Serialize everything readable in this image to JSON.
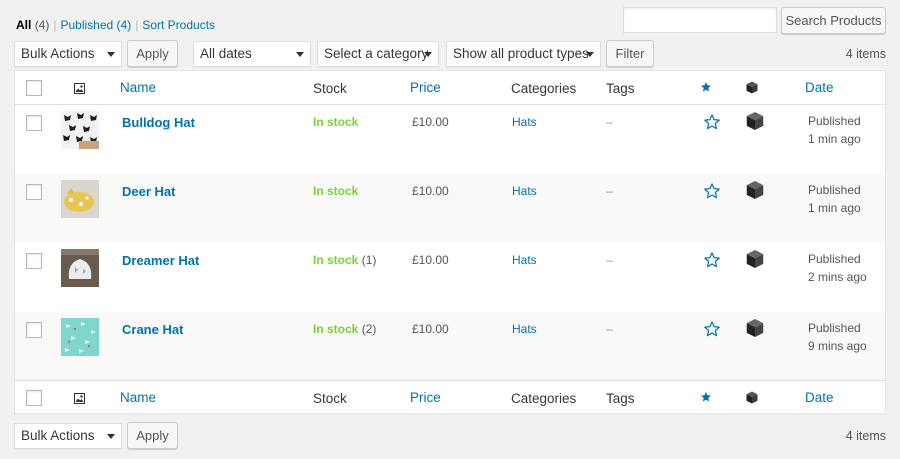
{
  "filters": {
    "all_label": "All",
    "all_count": "(4)",
    "published_label": "Published",
    "published_count": "(4)",
    "sort_label": "Sort Products",
    "separator": "|"
  },
  "search": {
    "value": "",
    "button_label": "Search Products"
  },
  "toolbar_top": {
    "bulk_actions": "Bulk Actions",
    "apply_label": "Apply",
    "dates": "All dates",
    "category": "Select a category",
    "product_type": "Show all product types",
    "filter_label": "Filter",
    "items_count": "4 items"
  },
  "table": {
    "headers": {
      "name": "Name",
      "stock": "Stock",
      "price": "Price",
      "categories": "Categories",
      "tags": "Tags",
      "date": "Date"
    },
    "rows": [
      {
        "name": "Bulldog Hat",
        "stock": "In stock",
        "stock_count": "",
        "price": "£10.00",
        "category": "Hats",
        "tags": "–",
        "status": "Published",
        "ago": "1 min ago"
      },
      {
        "name": "Deer Hat",
        "stock": "In stock",
        "stock_count": "",
        "price": "£10.00",
        "category": "Hats",
        "tags": "–",
        "status": "Published",
        "ago": "1 min ago"
      },
      {
        "name": "Dreamer Hat",
        "stock": "In stock",
        "stock_count": "(1)",
        "price": "£10.00",
        "category": "Hats",
        "tags": "–",
        "status": "Published",
        "ago": "2 mins ago"
      },
      {
        "name": "Crane Hat",
        "stock": "In stock",
        "stock_count": "(2)",
        "price": "£10.00",
        "category": "Hats",
        "tags": "–",
        "status": "Published",
        "ago": "9 mins ago"
      }
    ]
  },
  "toolbar_bottom": {
    "bulk_actions": "Bulk Actions",
    "apply_label": "Apply",
    "items_count": "4 items"
  },
  "colors": {
    "link": "#0073aa",
    "in_stock": "#7ad03a",
    "background": "#f1f1f1"
  },
  "icons": {
    "image_column": "image-icon",
    "featured_column": "star-icon",
    "type_column": "box-icon",
    "featured_row": "star-outline-icon",
    "type_row": "box-icon"
  }
}
